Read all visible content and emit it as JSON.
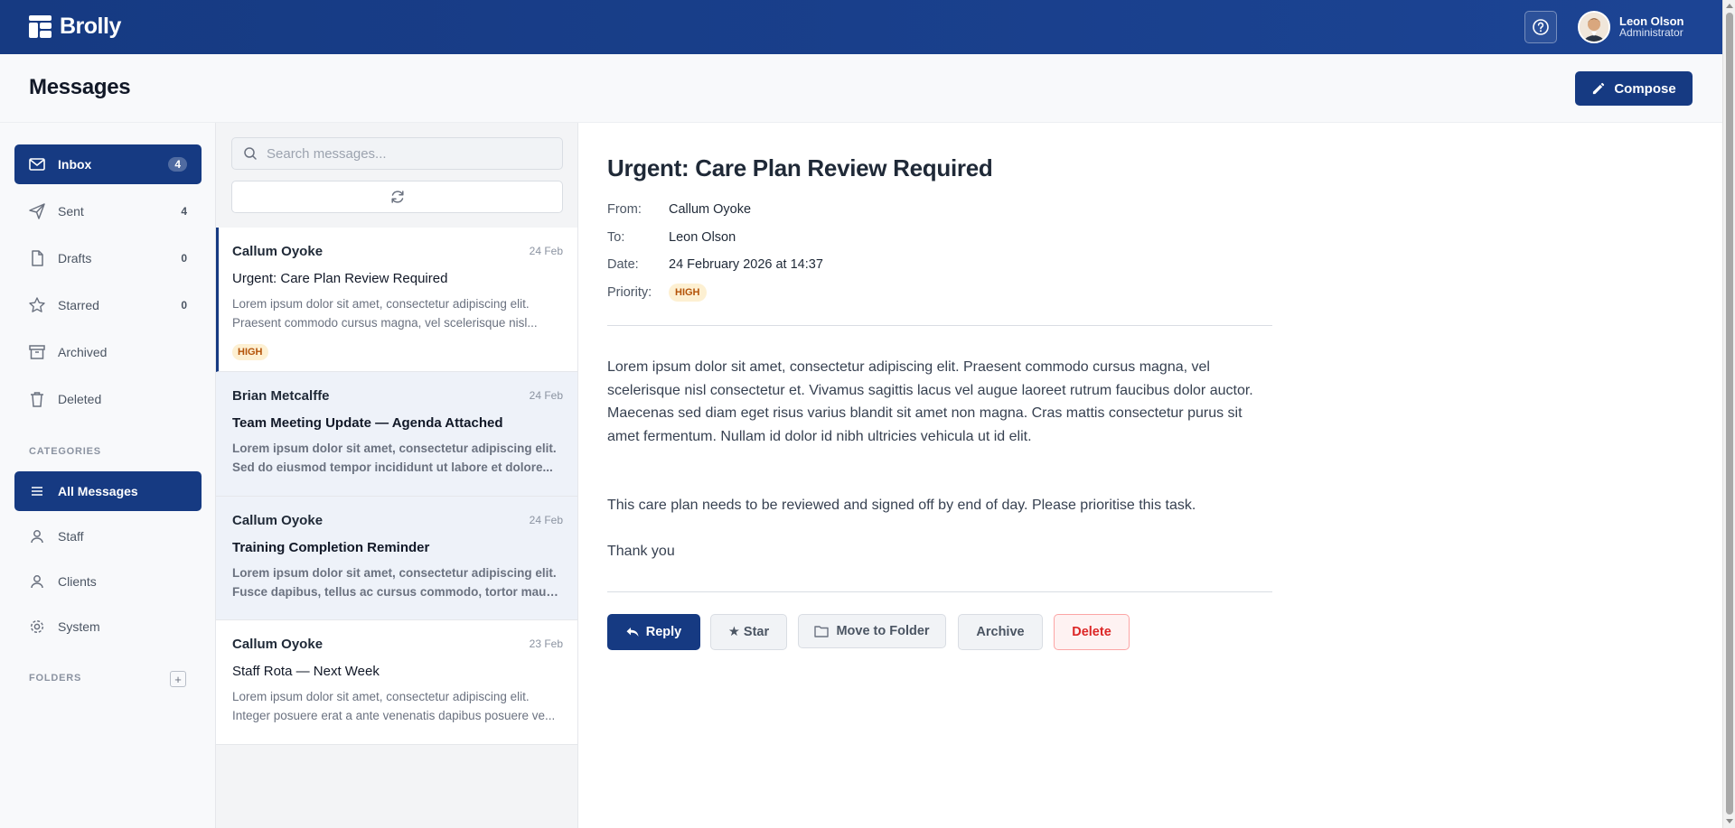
{
  "app": {
    "name": "Brolly"
  },
  "user": {
    "name": "Leon Olson",
    "role": "Administrator"
  },
  "page": {
    "title": "Messages",
    "compose_label": "Compose"
  },
  "sidebar": {
    "items": [
      {
        "label": "Inbox",
        "count": "4",
        "icon": "inbox-icon"
      },
      {
        "label": "Sent",
        "count": "4",
        "icon": "send-icon"
      },
      {
        "label": "Drafts",
        "count": "0",
        "icon": "file-icon"
      },
      {
        "label": "Starred",
        "count": "0",
        "icon": "star-icon"
      },
      {
        "label": "Archived",
        "count": "",
        "icon": "archive-icon"
      },
      {
        "label": "Deleted",
        "count": "",
        "icon": "trash-icon"
      }
    ],
    "categories_label": "CATEGORIES",
    "categories": [
      {
        "label": "All Messages",
        "icon": "list-icon"
      },
      {
        "label": "Staff",
        "icon": "user-icon"
      },
      {
        "label": "Clients",
        "icon": "user-icon"
      },
      {
        "label": "System",
        "icon": "gear-icon"
      }
    ],
    "folders_label": "FOLDERS",
    "folder_add": "+"
  },
  "search": {
    "placeholder": "Search messages..."
  },
  "messages": [
    {
      "from": "Callum Oyoke",
      "date": "24 Feb",
      "subject": "Urgent: Care Plan Review Required",
      "preview1": "Lorem ipsum dolor sit amet, consectetur adipiscing elit.",
      "preview2": "Praesent commodo cursus magna, vel scelerisque nisl...",
      "badge": "HIGH"
    },
    {
      "from": "Brian Metcalffe",
      "date": "24 Feb",
      "subject": "Team Meeting Update — Agenda Attached",
      "preview1": "Lorem ipsum dolor sit amet, consectetur adipiscing elit.",
      "preview2": "Sed do eiusmod tempor incididunt ut labore et dolore..."
    },
    {
      "from": "Callum Oyoke",
      "date": "24 Feb",
      "subject": "Training Completion Reminder",
      "preview1": "Lorem ipsum dolor sit amet, consectetur adipiscing elit.",
      "preview2": "Fusce dapibus, tellus ac cursus commodo, tortor mauris..."
    },
    {
      "from": "Callum Oyoke",
      "date": "23 Feb",
      "subject": "Staff Rota — Next Week",
      "preview1": "Lorem ipsum dolor sit amet, consectetur adipiscing elit.",
      "preview2": "Integer posuere erat a ante venenatis dapibus posuere ve..."
    }
  ],
  "reader": {
    "subject": "Urgent: Care Plan Review Required",
    "from_label": "From:",
    "from": "Callum Oyoke",
    "to_label": "To:",
    "to": "Leon Olson",
    "date_label": "Date:",
    "date": "24 February 2026 at 14:37",
    "priority_label": "Priority:",
    "priority": "HIGH",
    "body": [
      "Lorem ipsum dolor sit amet, consectetur adipiscing elit. Praesent commodo cursus magna, vel scelerisque nisl consectetur et. Vivamus sagittis lacus vel augue laoreet rutrum faucibus dolor auctor.",
      "Maecenas sed diam eget risus varius blandit sit amet non magna. Cras mattis consectetur purus sit amet fermentum. Nullam id dolor id nibh ultricies vehicula ut id elit.",
      "This care plan needs to be reviewed and signed off by end of day. Please prioritise this task.",
      "Thank you"
    ],
    "actions": {
      "reply": "Reply",
      "star": "★ Star",
      "move": "Move to Folder",
      "archive": "Archive",
      "delete": "Delete"
    }
  },
  "colors": {
    "brand": "#163a82",
    "high_badge_bg": "#fdf0d2",
    "high_badge_text": "#b45309",
    "delete": "#dc2626"
  }
}
